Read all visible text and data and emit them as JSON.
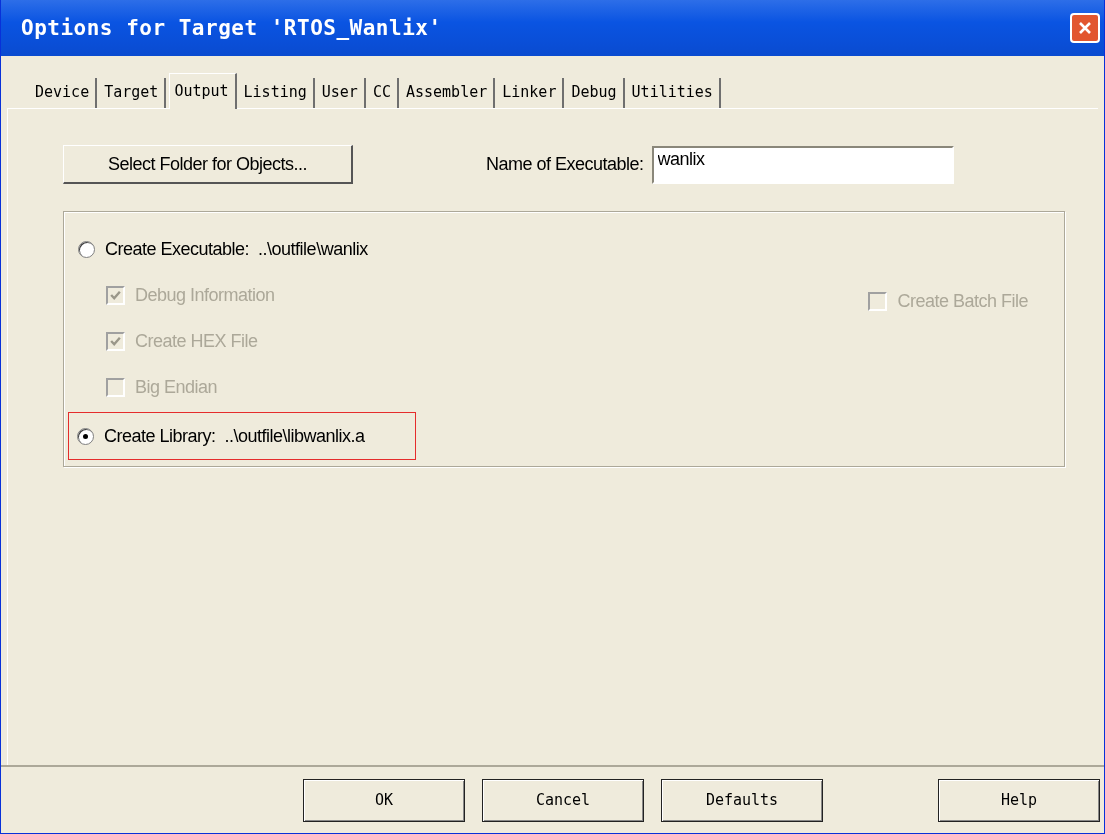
{
  "window": {
    "title": "Options for Target 'RTOS_Wanlix'"
  },
  "tabs": [
    {
      "label": "Device",
      "selected": false
    },
    {
      "label": "Target",
      "selected": false
    },
    {
      "label": "Output",
      "selected": true
    },
    {
      "label": "Listing",
      "selected": false
    },
    {
      "label": "User",
      "selected": false
    },
    {
      "label": "CC",
      "selected": false
    },
    {
      "label": "Assembler",
      "selected": false
    },
    {
      "label": "Linker",
      "selected": false
    },
    {
      "label": "Debug",
      "selected": false
    },
    {
      "label": "Utilities",
      "selected": false
    }
  ],
  "select_folder_button": "Select Folder for Objects...",
  "executable_name": {
    "label": "Name of Executable:",
    "value": "wanlix"
  },
  "options": [
    {
      "kind": "radio",
      "label": "Create Executable:  ..\\outfile\\wanlix",
      "selected": false,
      "highlighted": false
    },
    {
      "kind": "checkbox",
      "label": "Debug Information",
      "checked": true,
      "disabled": true
    },
    {
      "kind": "checkbox",
      "label": "Create HEX File",
      "checked": true,
      "disabled": true
    },
    {
      "kind": "checkbox",
      "label": "Big Endian",
      "checked": false,
      "disabled": true
    },
    {
      "kind": "radio",
      "label": "Create Library:  ..\\outfile\\libwanlix.a",
      "selected": true,
      "highlighted": true
    }
  ],
  "batch_file": {
    "kind": "checkbox",
    "label": "Create Batch File",
    "checked": false,
    "disabled": true
  },
  "buttons": [
    {
      "label": "OK"
    },
    {
      "label": "Cancel"
    },
    {
      "label": "Defaults"
    },
    {
      "label": "Help"
    }
  ]
}
